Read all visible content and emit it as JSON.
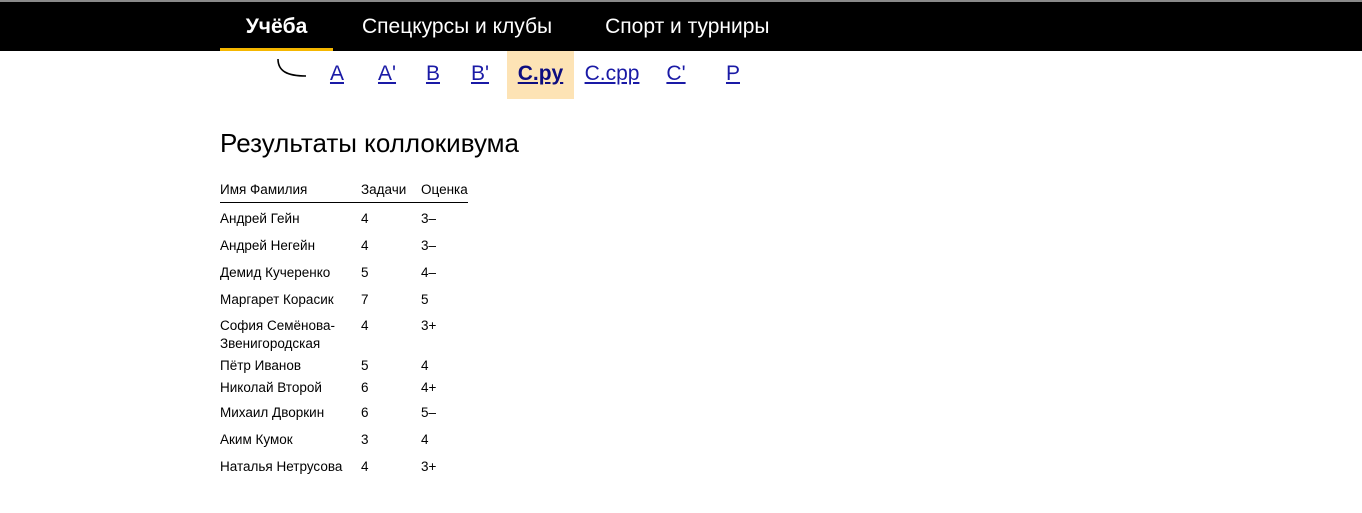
{
  "nav": {
    "items": [
      {
        "label": "Учёба",
        "active": true
      },
      {
        "label": "Спецкурсы и клубы",
        "active": false
      },
      {
        "label": "Спорт и турниры",
        "active": false
      }
    ]
  },
  "groups": {
    "tabs": [
      {
        "label": "A",
        "active": false
      },
      {
        "label": "A'",
        "active": false
      },
      {
        "label": "B",
        "active": false
      },
      {
        "label": "B'",
        "active": false
      },
      {
        "label": "C.py",
        "active": true
      },
      {
        "label": "C.cpp",
        "active": false
      },
      {
        "label": "C'",
        "active": false
      },
      {
        "label": "P",
        "active": false
      }
    ]
  },
  "page": {
    "title": "Результаты коллокивума"
  },
  "table": {
    "headers": {
      "name": "Имя Фамилия",
      "tasks": "Задачи",
      "grade": "Оценка"
    },
    "rows": [
      {
        "name": "Андрей Гейн",
        "tasks": "4",
        "grade": "3–"
      },
      {
        "name": "Андрей Негейн",
        "tasks": "4",
        "grade": "3–"
      },
      {
        "name": "Демид Кучеренко",
        "tasks": "5",
        "grade": "4–"
      },
      {
        "name": "Маргарет Корасик",
        "tasks": "7",
        "grade": "5"
      },
      {
        "name": "София Семёнова-Звенигородская",
        "tasks": "4",
        "grade": "3+"
      },
      {
        "name": "Пётр Иванов",
        "tasks": "5",
        "grade": "4"
      },
      {
        "name": "Николай Второй",
        "tasks": "6",
        "grade": "4+"
      },
      {
        "name": "Михаил Дворкин",
        "tasks": "6",
        "grade": "5–"
      },
      {
        "name": "Аким Кумок",
        "tasks": "3",
        "grade": "4"
      },
      {
        "name": "Наталья Нетрусова",
        "tasks": "4",
        "grade": "3+"
      }
    ]
  },
  "colors": {
    "topbar_bg": "#000000",
    "active_underline": "#f5b700",
    "active_group_bg": "#fde3b5",
    "link": "#1a1aa6"
  }
}
